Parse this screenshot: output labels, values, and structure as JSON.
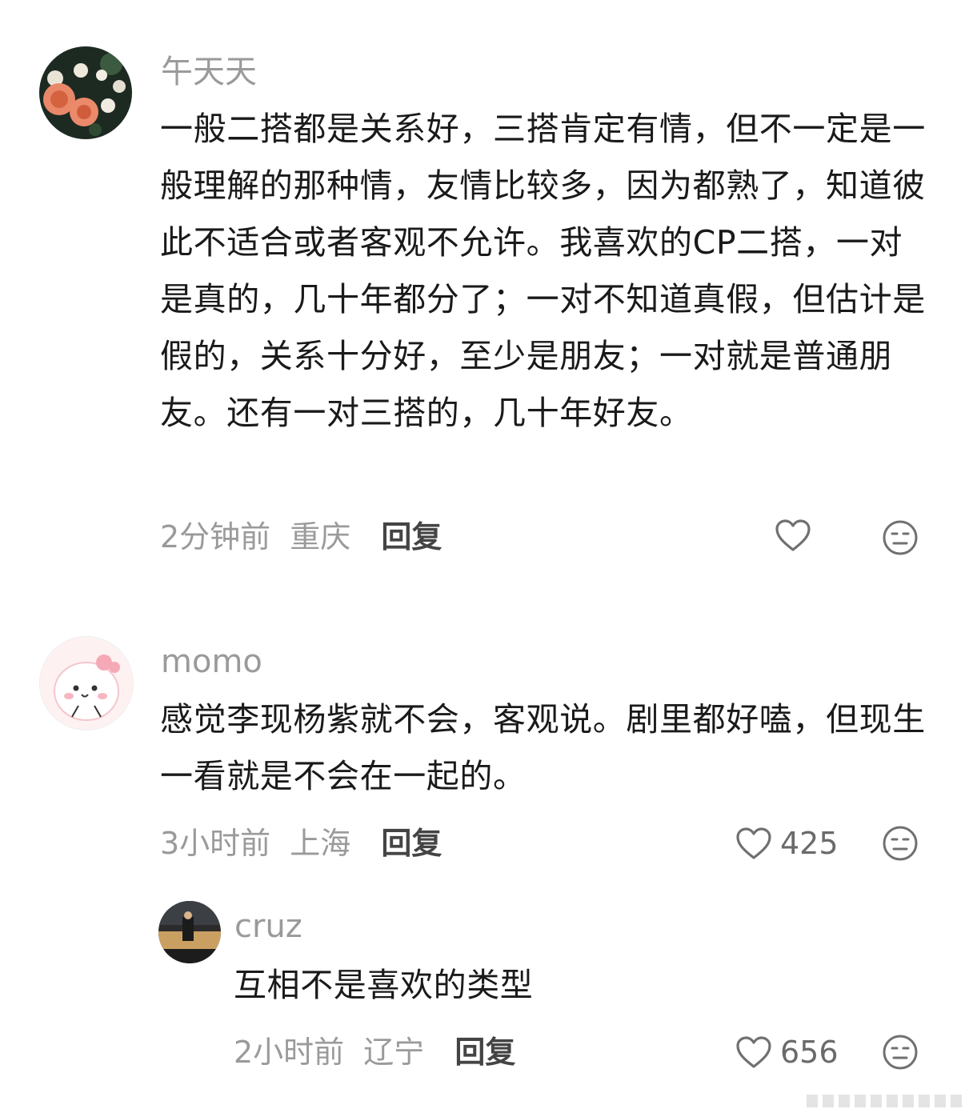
{
  "comments": [
    {
      "username": "午天天",
      "text": "一般二搭都是关系好，三搭肯定有情，但不一定是一般理解的那种情，友情比较多，因为都熟了，知道彼此不适合或者客观不允许。我喜欢的CP二搭，一对是真的，几十年都分了；一对不知道真假，但估计是假的，关系十分好，至少是朋友；一对就是普通朋友。还有一对三搭的，几十年好友。",
      "time": "2分钟前",
      "location": "重庆",
      "reply_label": "回复",
      "likes": ""
    },
    {
      "username": "momo",
      "text": "感觉李现杨紫就不会，客观说。剧里都好嗑，但现生一看就是不会在一起的。",
      "time": "3小时前",
      "location": "上海",
      "reply_label": "回复",
      "likes": "425",
      "replies": [
        {
          "username": "cruz",
          "text": "互相不是喜欢的类型",
          "time": "2小时前",
          "location": "辽宁",
          "reply_label": "回复",
          "likes": "656"
        }
      ]
    }
  ],
  "icons": {
    "like": "heart-outline-icon",
    "dislike": "meh-face-icon"
  },
  "colors": {
    "meta_gray": "#9a9a9a",
    "text": "#1a1a1a",
    "reply": "#444444",
    "icon": "#707070"
  }
}
